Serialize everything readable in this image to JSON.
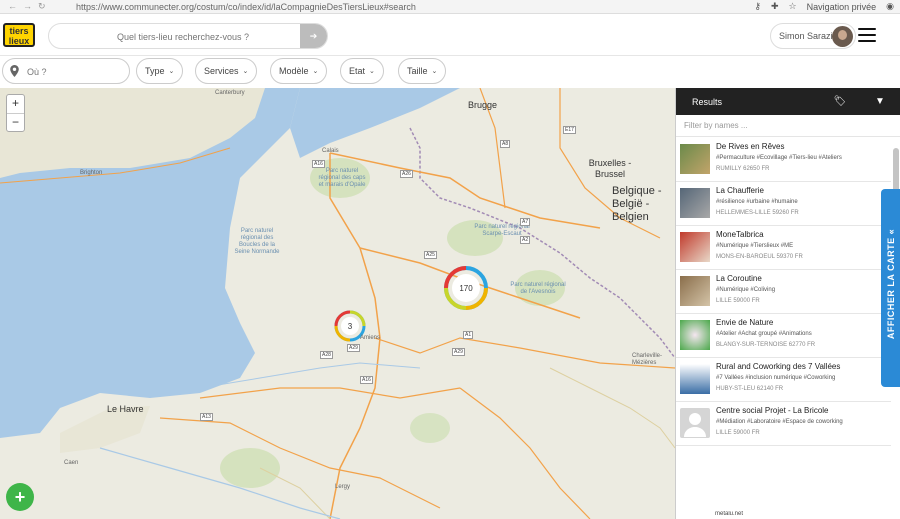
{
  "browser": {
    "url": "https://www.communecter.org/costum/co/index/id/laCompagnieDesTiersLieux#search",
    "private_label": "Navigation privée"
  },
  "header": {
    "logo_text": "tiers lieux",
    "search_placeholder": "Quel tiers-lieu recherchez-vous ?",
    "user_name": "Simon Sarazin"
  },
  "filters": {
    "where_placeholder": "Où ?",
    "buttons": [
      "Type",
      "Services",
      "Modèle",
      "Etat",
      "Taille"
    ]
  },
  "map": {
    "zoom_in": "+",
    "zoom_out": "−",
    "clusters": [
      {
        "count": "3"
      },
      {
        "count": "170"
      }
    ],
    "cities": [
      "Canterbury",
      "Brugge",
      "Calais",
      "Bruxelles - Brussel",
      "Belgique - België - Belgien",
      "Brighton",
      "Amiens",
      "Le Havre",
      "Caen",
      "Lergy",
      "Charleville-Mézières"
    ],
    "regions": [
      "Parc naturel régional des caps et marais d'Opale",
      "Parc naturel régional Scarpe-Escaut",
      "Parc naturel régional de l'Avesnois",
      "Parc naturel régional des Boucles de la Seine Normande"
    ],
    "roads": [
      "A16",
      "A26",
      "A25",
      "A1",
      "A28",
      "A29",
      "A13",
      "A16",
      "A29",
      "A2",
      "A7",
      "E17",
      "A8"
    ],
    "add_label": "+",
    "colors": {
      "cluster_ring": [
        "#e53935",
        "#2ba4e0",
        "#c8d52b",
        "#f0b400"
      ],
      "sea": "#a9c9e6",
      "land": "#ecebe1"
    }
  },
  "results": {
    "title": "Results",
    "filter_placeholder": "Filter by names ...",
    "items": [
      {
        "name": "De Rives en Rêves",
        "tags": "#Permaculture #Ecovillage #Tiers-lieu #Ateliers",
        "addr": "RUMILLY 62650 FR"
      },
      {
        "name": "La Chaufferie",
        "tags": "#résilience #urbaine #humaine",
        "addr": "HELLEMMES-LILLE 59260 FR"
      },
      {
        "name": "MoneTalbrica",
        "tags": "#Numérique #Tierslieux #ME",
        "addr": "MONS-EN-BAROEUL 59370 FR"
      },
      {
        "name": "La Coroutine",
        "tags": "#Numérique #Coliving",
        "addr": "LILLE 59000 FR"
      },
      {
        "name": "Envie de Nature",
        "tags": "#Atelier #Achat groupé #Animations",
        "addr": "BLANGY-SUR-TERNOISE 62770 FR"
      },
      {
        "name": "Rural and Coworking des 7 Vallées",
        "tags": "#7 Vallées #inclusion numérique #Coworking",
        "addr": "HUBY-ST-LEU 62140 FR"
      },
      {
        "name": "Centre social Projet - La Bricole",
        "tags": "#Médiation #Laboratoire #Espace de coworking",
        "addr": "LILLE 59000 FR"
      }
    ],
    "next_item_partial": "metalu.net",
    "show_map_label": "AFFICHER LA CARTE «"
  }
}
